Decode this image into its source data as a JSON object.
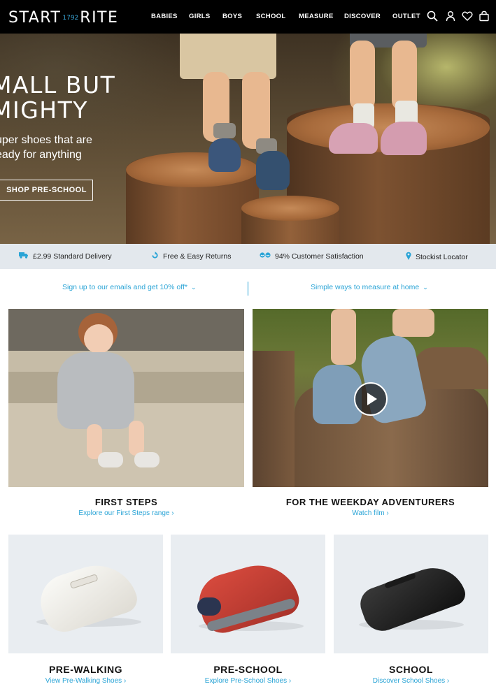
{
  "header": {
    "logo_left": "START",
    "logo_year": "1792",
    "logo_right": "RITE",
    "nav": [
      "BABIES",
      "GIRLS",
      "BOYS",
      "SCHOOL",
      "MEASURE",
      "DISCOVER",
      "OUTLET"
    ],
    "icons": [
      "search-icon",
      "account-icon",
      "wishlist-heart-icon",
      "basket-icon"
    ]
  },
  "hero": {
    "title_line1": "MALL BUT",
    "title_line2": "MIGHTY",
    "subtitle_line1": "uper shoes that are",
    "subtitle_line2": "eady for anything",
    "cta": "SHOP PRE-SCHOOL"
  },
  "benefits": [
    {
      "icon": "delivery-truck-icon",
      "label": "£2.99 Standard Delivery"
    },
    {
      "icon": "returns-arrow-icon",
      "label": "Free & Easy Returns"
    },
    {
      "icon": "satisfaction-icon",
      "label": "94% Customer Satisfaction"
    },
    {
      "icon": "location-pin-icon",
      "label": "Stockist Locator"
    }
  ],
  "promos": [
    {
      "label": "Sign up to our emails and get 10% off*",
      "icon": "chevron-down-icon"
    },
    {
      "label": "Simple ways to measure at home",
      "icon": "chevron-down-icon"
    }
  ],
  "features": [
    {
      "title": "FIRST STEPS",
      "link": "Explore our First Steps range ›"
    },
    {
      "title": "FOR THE WEEKDAY ADVENTURERS",
      "link": "Watch film ›"
    }
  ],
  "products": [
    {
      "title": "PRE-WALKING",
      "link": "View Pre-Walking Shoes ›"
    },
    {
      "title": "PRE-SCHOOL",
      "link": "Explore Pre-School Shoes ›"
    },
    {
      "title": "SCHOOL",
      "link": "Discover School Shoes ›"
    }
  ],
  "colors": {
    "accent": "#2aa4d6",
    "header_bg": "#000000",
    "benefits_bg": "#e3e8ed"
  }
}
